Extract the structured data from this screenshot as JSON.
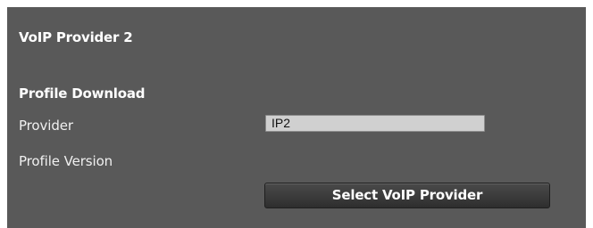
{
  "panel": {
    "title": "VoIP Provider 2",
    "background_color": "#595959"
  },
  "profile_download": {
    "section_title": "Profile Download",
    "provider_label": "Provider",
    "provider_value": "IP2",
    "profile_version_label": "Profile Version",
    "select_button_label": "Select VoIP Provider"
  }
}
